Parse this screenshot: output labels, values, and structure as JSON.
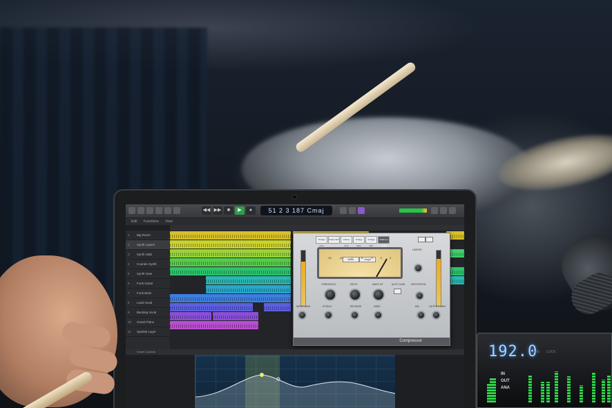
{
  "daw": {
    "lcd": "51 2 3 187 Cmaj",
    "menu": [
      "Edit",
      "Functions",
      "View"
    ],
    "tracks": [
      {
        "num": "1",
        "name": "Big Room"
      },
      {
        "num": "2",
        "name": "Synth Layers"
      },
      {
        "num": "3",
        "name": "Synth Stab"
      },
      {
        "num": "4",
        "name": "Counter Synth"
      },
      {
        "num": "5",
        "name": "Synth Note"
      },
      {
        "num": "6",
        "name": "Funk Guitar"
      },
      {
        "num": "7",
        "name": "Funk Bass"
      },
      {
        "num": "8",
        "name": "Lead Vocal"
      },
      {
        "num": "9",
        "name": "Backing Vocal"
      },
      {
        "num": "10",
        "name": "Grand Piano"
      },
      {
        "num": "11",
        "name": "Sparkle Layer"
      }
    ],
    "editor_label": "Smart Controls"
  },
  "plugin": {
    "tabs": [
      "Vintage VCA",
      "Studio FET",
      "Classic VCA",
      "Vintage Opto",
      "Vintage FET",
      "Platinum Digital"
    ],
    "vu_modes": [
      "Meter",
      "Graph"
    ],
    "vu_scale": [
      "-20",
      "-10",
      "-7",
      "-5",
      "-3",
      "0",
      "3"
    ],
    "knobs": [
      "Threshold",
      "Ratio",
      "Make Up",
      "Auto Gain",
      "Attack",
      "Release",
      "Knee",
      "Mix",
      "Output Gain",
      "Input Gain",
      "Limiter",
      "Distortion"
    ],
    "brand": "Compressor"
  },
  "interface": {
    "sample_rate": "192.0",
    "labels": [
      "kHz",
      "LOCK"
    ],
    "io": [
      "IN",
      "OUT",
      "ANA"
    ],
    "meter_levels": [
      0.55,
      0.7,
      0.8,
      0.6,
      0.9,
      0.75,
      0.5,
      0.85,
      0.65,
      0.8,
      0.7,
      0.6
    ],
    "accent": "#a8d2ff"
  }
}
